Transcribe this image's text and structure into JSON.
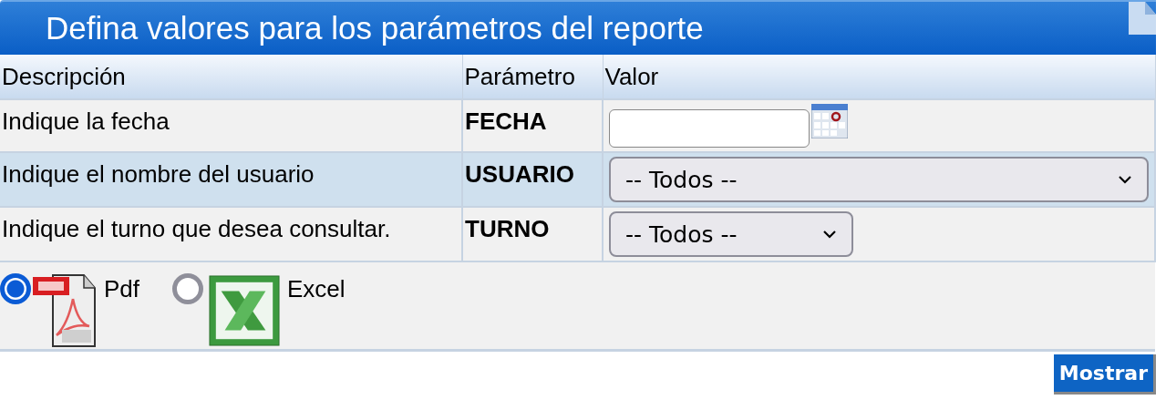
{
  "title": "Defina valores para los parámetros del reporte",
  "columns": [
    "Descripción",
    "Parámetro",
    "Valor"
  ],
  "rows": [
    {
      "description": "Indique la fecha",
      "parameter": "FECHA",
      "kind": "date",
      "highlighted": false
    },
    {
      "description": "Indique el nombre del usuario",
      "parameter": "USUARIO",
      "kind": "select",
      "value": "-- Todos --",
      "wide": true,
      "highlighted": true
    },
    {
      "description": "Indique el turno que desea consultar.",
      "parameter": "TURNO",
      "kind": "select",
      "value": "-- Todos --",
      "wide": false,
      "highlighted": false
    }
  ],
  "formats": [
    {
      "label": "Pdf",
      "kind": "pdf",
      "selected": true
    },
    {
      "label": "Excel",
      "kind": "excel",
      "selected": false
    }
  ],
  "button": "Mostrar"
}
